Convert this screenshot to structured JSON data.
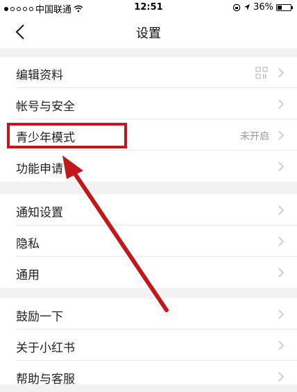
{
  "status_bar": {
    "carrier": "中国联通",
    "time": "12:51",
    "battery": "36%",
    "battery_level": 0.36,
    "signal_dots_filled": 1,
    "signal_dots_total": 5
  },
  "nav": {
    "title": "设置",
    "back_icon": "chevron-left-icon"
  },
  "sections": [
    {
      "items": [
        {
          "label": "编辑资料",
          "value": "",
          "icon": "qr-code-icon"
        },
        {
          "label": "帐号与安全",
          "value": ""
        },
        {
          "label": "青少年模式",
          "value": "未开启"
        },
        {
          "label": "功能申请",
          "value": ""
        }
      ]
    },
    {
      "items": [
        {
          "label": "通知设置",
          "value": ""
        },
        {
          "label": "隐私",
          "value": ""
        },
        {
          "label": "通用",
          "value": ""
        }
      ]
    },
    {
      "items": [
        {
          "label": "鼓励一下",
          "value": ""
        },
        {
          "label": "关于小红书",
          "value": ""
        },
        {
          "label": "帮助与客服",
          "value": ""
        }
      ]
    }
  ],
  "annotation": {
    "color": "#c0181b",
    "highlighted_item": "青少年模式"
  }
}
